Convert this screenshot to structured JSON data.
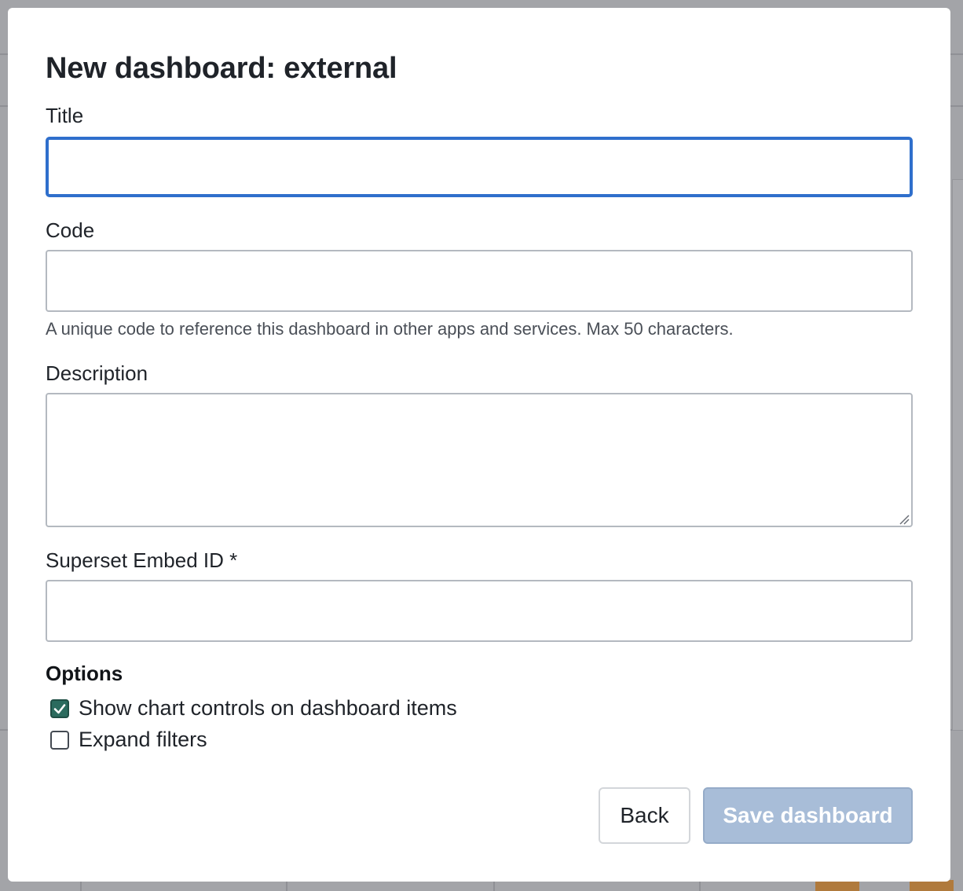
{
  "modal": {
    "title": "New dashboard: external"
  },
  "form": {
    "title_field": {
      "label": "Title",
      "value": ""
    },
    "code_field": {
      "label": "Code",
      "value": "",
      "help": "A unique code to reference this dashboard in other apps and services. Max 50 characters."
    },
    "description_field": {
      "label": "Description",
      "value": ""
    },
    "embed_field": {
      "label": "Superset Embed ID *",
      "value": ""
    },
    "options": {
      "heading": "Options",
      "items": [
        {
          "label": "Show chart controls on dashboard items",
          "checked": true
        },
        {
          "label": "Expand filters",
          "checked": false
        }
      ]
    }
  },
  "actions": {
    "back_label": "Back",
    "save_label": "Save dashboard"
  },
  "colors": {
    "focus_border": "#2f6fcc",
    "checkbox_checked": "#2b6b5e",
    "save_disabled": "#a8bdd8"
  }
}
